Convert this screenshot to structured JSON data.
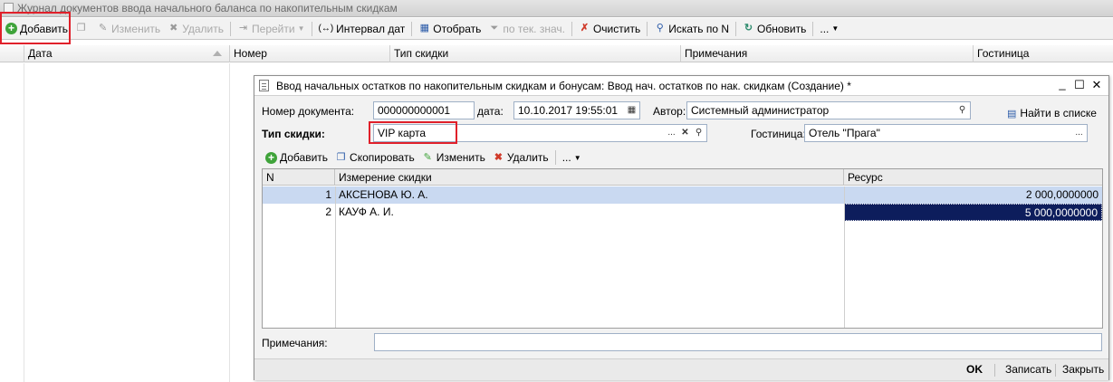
{
  "journal": {
    "title": "Журнал документов ввода начального баланса по накопительным скидкам",
    "toolbar": {
      "add": "Добавить",
      "edit": "Изменить",
      "delete": "Удалить",
      "goto": "Перейти",
      "date_interval": "Интервал дат",
      "select": "Отобрать",
      "by_current_value": "по тек. знач.",
      "clear": "Очистить",
      "search_by_n": "Искать по N",
      "refresh": "Обновить",
      "more": "..."
    },
    "columns": [
      "Дата",
      "Номер",
      "Тип скидки",
      "Примечания",
      "Гостиница"
    ]
  },
  "dialog": {
    "title": "Ввод начальных остатков по накопительным скидкам и бонусам: Ввод нач. остатков по нак. скидкам (Создание) *",
    "doc_number_label": "Номер документа:",
    "doc_number": "000000000001",
    "date_label": "дата:",
    "date": "10.10.2017 19:55:01",
    "author_label": "Автор:",
    "author": "Системный администратор",
    "find_in_list": "Найти в списке",
    "discount_type_label": "Тип скидки:",
    "discount_type": "VIP карта",
    "hotel_label": "Гостиница:",
    "hotel": "Отель \"Прага\"",
    "subtoolbar": {
      "add": "Добавить",
      "copy": "Скопировать",
      "edit": "Изменить",
      "delete": "Удалить",
      "more": "..."
    },
    "table": {
      "headers": {
        "n": "N",
        "dimension": "Измерение скидки",
        "resource": "Ресурс"
      },
      "rows": [
        {
          "n": "1",
          "dimension": "АКСЕНОВА Ю. А.",
          "resource": "2 000,0000000"
        },
        {
          "n": "2",
          "dimension": "КАУФ А. И.",
          "resource": "5 000,0000000"
        }
      ]
    },
    "notes_label": "Примечания:",
    "notes": "",
    "buttons": {
      "ok": "OK",
      "save": "Записать",
      "close": "Закрыть"
    }
  }
}
